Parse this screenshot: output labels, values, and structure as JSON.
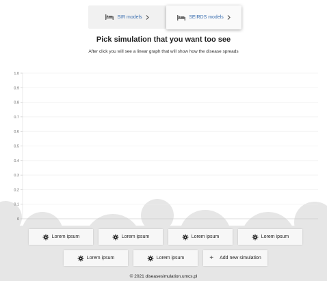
{
  "tabs": [
    {
      "label": "SIR models",
      "icon": "bed-icon",
      "active": false
    },
    {
      "label": "SEIRDS models",
      "icon": "bed-icon",
      "active": true
    }
  ],
  "heading": "Pick simulation that you want too see",
  "subheading": "After click you will see a linear graph that will show how the disease spreads",
  "chart_data": {
    "type": "line",
    "yticks": [
      "1.0",
      "0.9",
      "0.8",
      "0.7",
      "0.6",
      "0.5",
      "0.4",
      "0.3",
      "0.2",
      "0.1",
      "0"
    ],
    "ylim": [
      0,
      1
    ],
    "series": [],
    "grid": true
  },
  "simulations": [
    {
      "label": "Lorem ipsum",
      "icon": "virus-icon"
    },
    {
      "label": "Lorem ipsum",
      "icon": "virus-icon"
    },
    {
      "label": "Lorem ipsum",
      "icon": "virus-icon"
    },
    {
      "label": "Lorem ipsum",
      "icon": "virus-icon"
    },
    {
      "label": "Lorem ipsum",
      "icon": "virus-icon"
    },
    {
      "label": "Lorem ipsum",
      "icon": "virus-icon"
    }
  ],
  "add_button": {
    "label": "Add new simulation",
    "icon": "plus-icon"
  },
  "footer": "© 2021 diseasesimulation.umcs.pl",
  "colors": {
    "background_clouds": "#e6e6e6",
    "tab_text": "#3b6fb0",
    "grid": "#ececec"
  }
}
